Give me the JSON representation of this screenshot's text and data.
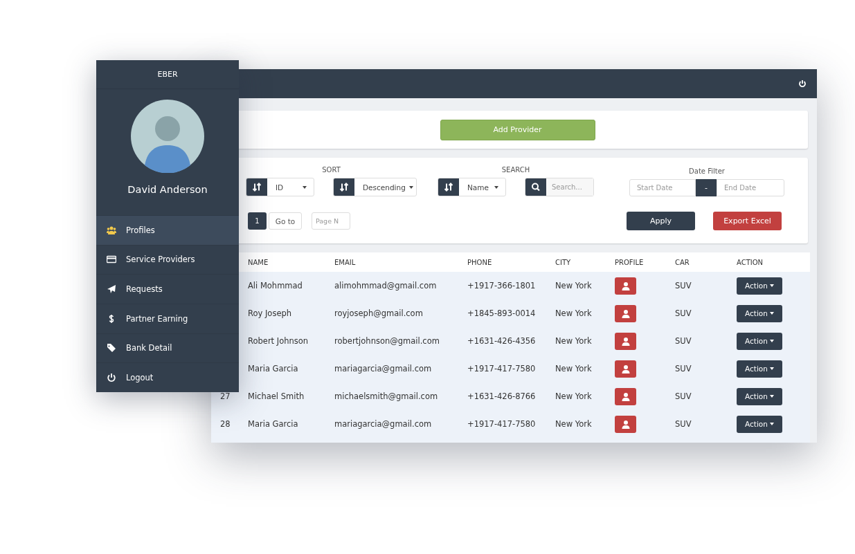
{
  "sidebar": {
    "brand": "EBER",
    "user_name": "David Anderson",
    "menu": [
      {
        "label": "Profiles",
        "kind": "users",
        "selected": true
      },
      {
        "label": "Service Providers",
        "kind": "card",
        "selected": false
      },
      {
        "label": "Requests",
        "kind": "plane",
        "selected": false
      },
      {
        "label": "Partner Earning",
        "kind": "dollar",
        "selected": false
      },
      {
        "label": "Bank Detail",
        "kind": "tag",
        "selected": false
      },
      {
        "label": "Logout",
        "kind": "power",
        "selected": false
      }
    ]
  },
  "toolbar": {
    "add_button": "Add Provider"
  },
  "filters": {
    "sort_label": "SORT",
    "sort_field": "ID",
    "sort_order": "Descending",
    "search_label": "SEARCH",
    "search_field": "Name",
    "search_placeholder": "Search...",
    "date_label": "Date Filter",
    "start_placeholder": "Start Date",
    "date_separator": "-",
    "end_placeholder": "End Date",
    "page": "1",
    "goto": "Go to",
    "page_placeholder": "Page N",
    "apply": "Apply",
    "export": "Export Excel"
  },
  "table": {
    "columns": [
      "NAME",
      "EMAIL",
      "PHONE",
      "CITY",
      "PROFILE",
      "CAR",
      "ACTION"
    ],
    "rows": [
      {
        "name": "Ali Mohmmad",
        "email": "alimohmmad@gmail.com",
        "phone": "+1917-366-1801",
        "city": "New York",
        "car": "SUV",
        "action": "Action"
      },
      {
        "name": "Roy Joseph",
        "email": "royjoseph@gmail.com",
        "phone": "+1845-893-0014",
        "city": "New York",
        "car": "SUV",
        "action": "Action"
      },
      {
        "name": "Robert Johnson",
        "email": "robertjohnson@gmail.com",
        "phone": "+1631-426-4356",
        "city": "New York",
        "car": "SUV",
        "action": "Action"
      },
      {
        "name": "Maria Garcia",
        "email": "mariagarcia@gmail.com",
        "phone": "+1917-417-7580",
        "city": "New York",
        "car": "SUV",
        "action": "Action"
      },
      {
        "id": "27",
        "name": "Michael Smith",
        "email": "michaelsmith@gmail.com",
        "phone": "+1631-426-8766",
        "city": "New York",
        "car": "SUV",
        "action": "Action"
      },
      {
        "id": "28",
        "name": "Maria Garcia",
        "email": "mariagarcia@gmail.com",
        "phone": "+1917-417-7580",
        "city": "New York",
        "car": "SUV",
        "action": "Action"
      }
    ]
  }
}
